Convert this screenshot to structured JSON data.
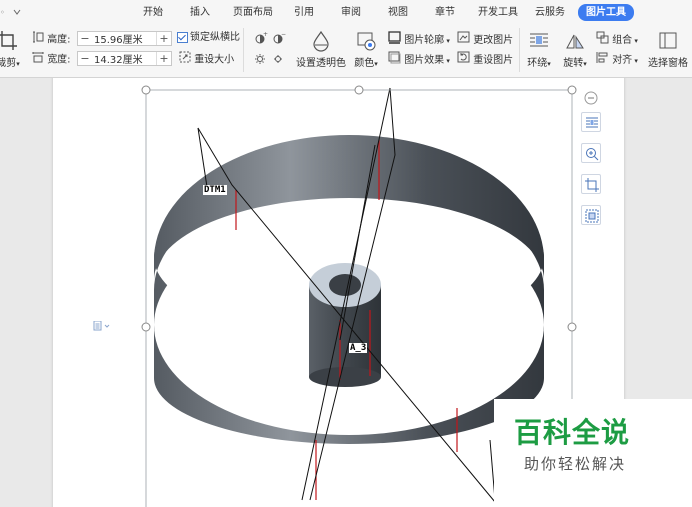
{
  "ribbon": {
    "tabs": [
      {
        "label": "开始"
      },
      {
        "label": "插入"
      },
      {
        "label": "页面布局"
      },
      {
        "label": "引用"
      },
      {
        "label": "审阅"
      },
      {
        "label": "视图"
      },
      {
        "label": "章节"
      },
      {
        "label": "开发工具"
      },
      {
        "label": "云服务"
      },
      {
        "label": "图片工具"
      }
    ],
    "active_tab": "图片工具",
    "crop_label": "裁剪",
    "height_label": "高度:",
    "height_value": "15.96厘米",
    "width_label": "宽度:",
    "width_value": "14.32厘米",
    "lock_ratio_label": "锁定纵横比",
    "lock_ratio_checked": true,
    "reset_size_label": "重设大小",
    "set_transparent_label": "设置透明色",
    "color_label": "颜色",
    "outline_label": "图片轮廓",
    "effect_label": "图片效果",
    "change_picture_label": "更改图片",
    "reset_picture_label": "重设图片",
    "wrap_label": "环绕",
    "rotate_label": "旋转",
    "group_label": "组合",
    "align_label": "对齐",
    "selection_pane_label": "选择窗格"
  },
  "document": {
    "image_label_1": "DTM1",
    "image_label_2": "A_3"
  },
  "watermark": {
    "title": "百科全说",
    "subtitle": "助你轻松解决"
  },
  "colors": {
    "accent": "#3c7cf0",
    "watermark_green": "#1d9c43",
    "ring_dark": "#474d54",
    "ring_light": "#8f959c"
  }
}
